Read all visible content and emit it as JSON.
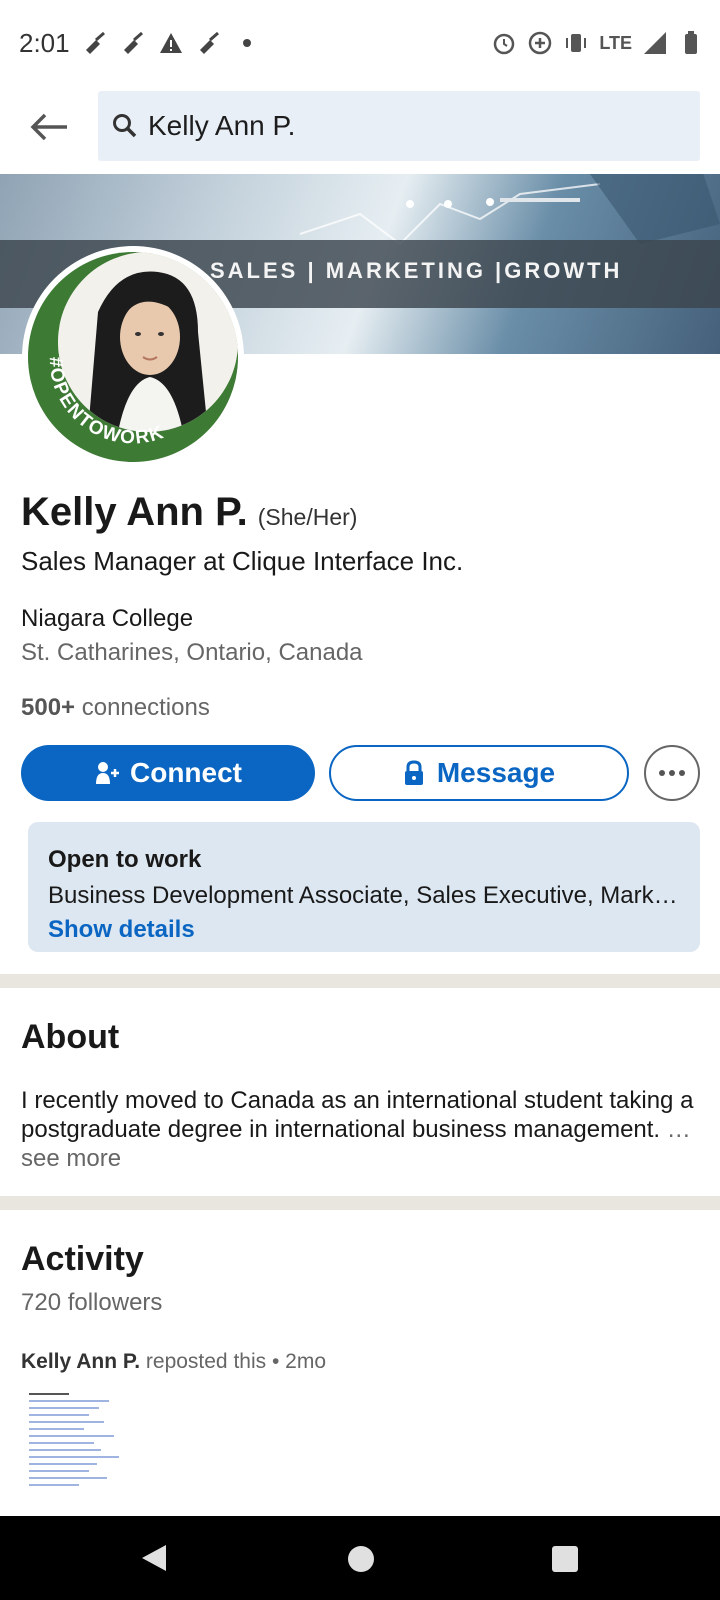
{
  "status_bar": {
    "time": "2:01",
    "network": "LTE",
    "left_icons": [
      "broom-icon",
      "broom-icon",
      "warning-icon",
      "broom-icon",
      "dot-icon"
    ],
    "right_icons": [
      "alarm-icon",
      "data-saver-icon",
      "vibrate-icon",
      "signal-icon",
      "battery-icon"
    ]
  },
  "search": {
    "query": "Kelly Ann P."
  },
  "banner": {
    "text": "SALES | MARKETING |GROWTH"
  },
  "avatar": {
    "badge_text": "#OPENTOWORK",
    "badge_color": "#3d7a34"
  },
  "profile": {
    "name": "Kelly Ann P.",
    "pronouns": "(She/Her)",
    "headline": "Sales Manager at Clique Interface Inc.",
    "education": "Niagara College",
    "location": "St. Catharines, Ontario, Canada",
    "connections_count": "500+",
    "connections_label": "connections"
  },
  "actions": {
    "connect_label": "Connect",
    "message_label": "Message",
    "accent_color": "#0a66c2"
  },
  "open_to_work": {
    "title": "Open to work",
    "roles": "Business Development Associate, Sales Executive, Marke…",
    "link": "Show details"
  },
  "about": {
    "title": "About",
    "text": "I recently moved to Canada as an international student taking a postgraduate degree in international business management.",
    "see_more": "… see more"
  },
  "activity": {
    "title": "Activity",
    "followers": "720 followers",
    "post_author": "Kelly Ann P.",
    "post_action": "reposted this • 2mo"
  }
}
